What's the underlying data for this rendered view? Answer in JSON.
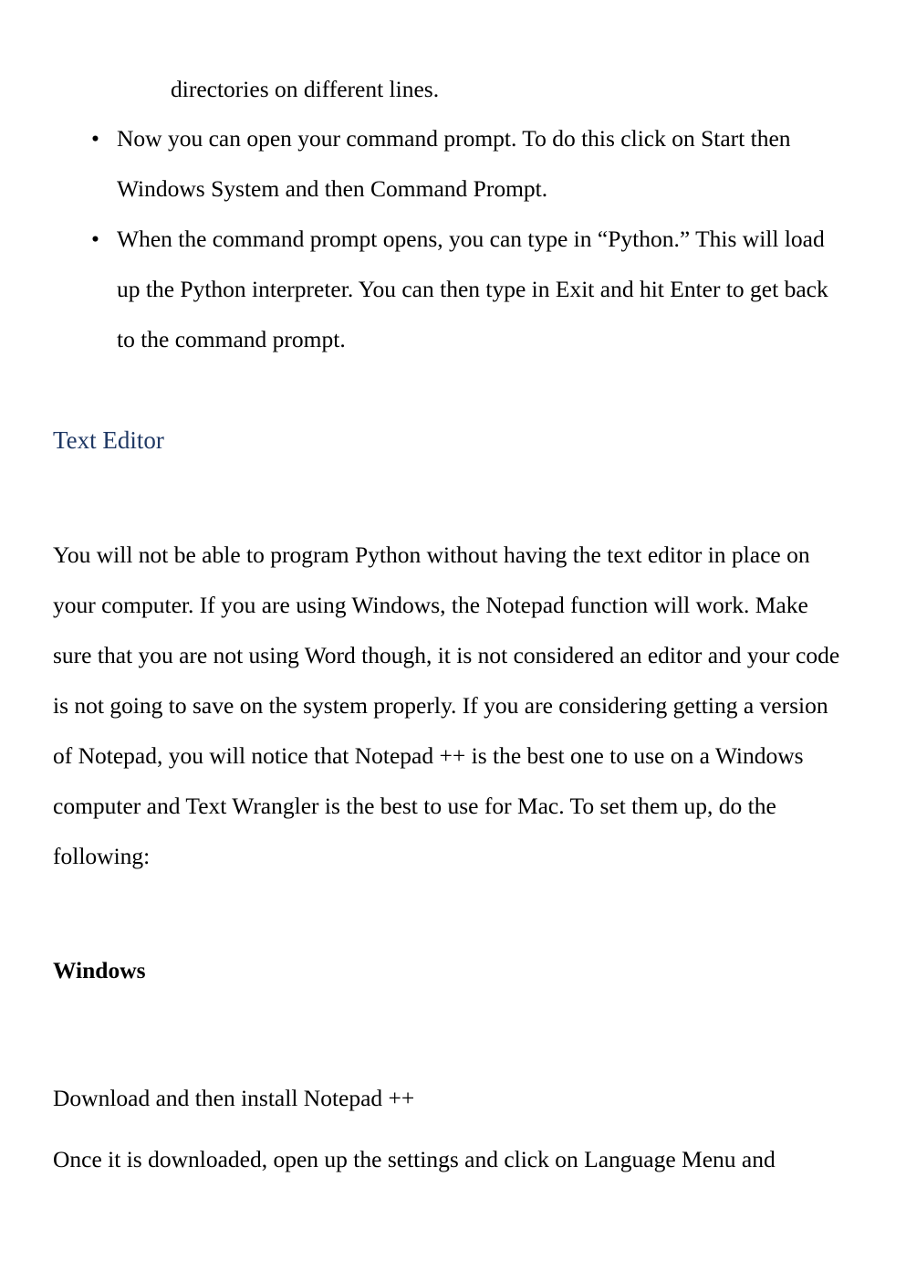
{
  "page": {
    "background_color": "#ffffff",
    "text_color": "#000000",
    "heading_color": "#1F3864"
  },
  "continuation": {
    "text": "directories on different lines."
  },
  "bullets": {
    "marker": "•",
    "items": [
      {
        "text": "Now you can open your command prompt. To do this click on Start then Windows System and then Command Prompt."
      },
      {
        "text": "When the command prompt opens, you can type in “Python.” This will load up the Python interpreter. You can then type in Exit and hit Enter to get back to the command prompt."
      }
    ]
  },
  "section": {
    "heading": "Text Editor",
    "paragraph": "You will not be able to program Python without having the text editor in place on your computer. If you are using Windows, the Notepad function will work. Make sure that you are not using Word though, it is not considered an editor and your code is not going to save on the system properly. If you are considering getting a version of Notepad, you will notice that Notepad ++ is the best one to use on a Windows computer and Text Wrangler is the best to use for Mac. To set them up, do the following:"
  },
  "subsection": {
    "heading": "Windows",
    "lines": [
      "Download and then install Notepad ++",
      "Once it is downloaded, open up the settings and click on Language Menu and"
    ]
  }
}
